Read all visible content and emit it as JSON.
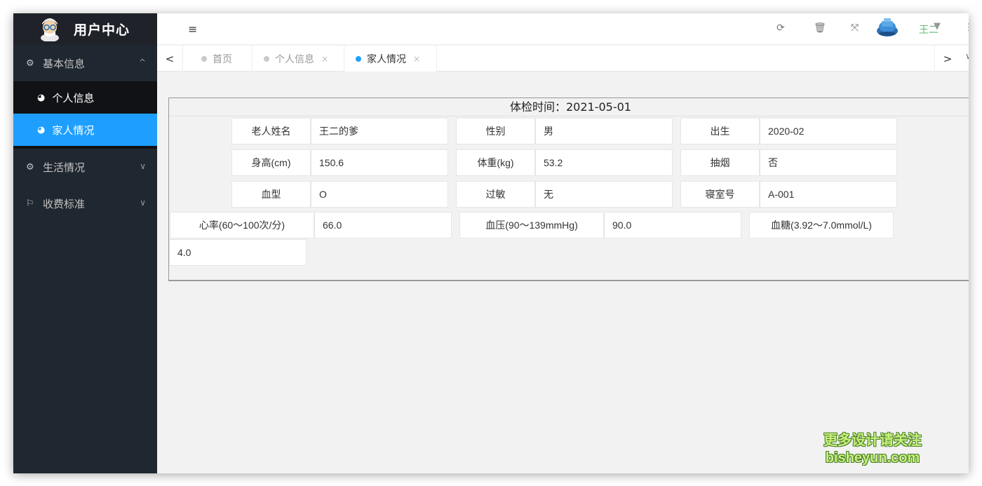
{
  "sidebar": {
    "title": "用户中心",
    "groups": [
      {
        "label": "基本信息",
        "icon": "gears-icon",
        "chevron": "^"
      },
      {
        "label": "生活情况",
        "icon": "gears-icon",
        "chevron": "∨"
      },
      {
        "label": "收费标准",
        "icon": "flag-icon",
        "chevron": "∨"
      }
    ],
    "sub_items": [
      {
        "label": "个人信息",
        "icon": "dashboard-icon"
      },
      {
        "label": "家人情况",
        "icon": "dashboard-icon"
      }
    ]
  },
  "header": {
    "fold_icon": "≡",
    "icons": [
      "refresh-icon",
      "trash-icon",
      "fullscreen-icon"
    ],
    "user_name": "王二",
    "caret": "▼",
    "dots": "⋮"
  },
  "tabs": {
    "left_arrow": "<",
    "right_arrow": ">",
    "more_arrow": "∨",
    "items": [
      {
        "label": "首页"
      },
      {
        "label": "个人信息",
        "close": "×"
      },
      {
        "label": "家人情况",
        "close": "×"
      }
    ]
  },
  "record": {
    "title": "体检时间：2021-05-01",
    "rows": [
      [
        {
          "label": "老人姓名",
          "value": "王二的爹"
        },
        {
          "label": "性别",
          "value": "男"
        },
        {
          "label": "出生",
          "value": "2020-02"
        }
      ],
      [
        {
          "label": "身高(cm)",
          "value": "150.6"
        },
        {
          "label": "体重(kg)",
          "value": "53.2"
        },
        {
          "label": "抽烟",
          "value": "否"
        }
      ],
      [
        {
          "label": "血型",
          "value": "O"
        },
        {
          "label": "过敏",
          "value": "无"
        },
        {
          "label": "寝室号",
          "value": "A-001"
        }
      ]
    ],
    "vitals": [
      {
        "label": "心率(60～100次/分)",
        "value": "66.0"
      },
      {
        "label": "血压(90～139mmHg)",
        "value": "90.0"
      },
      {
        "label": "血糖(3.92～7.0mmol/L)",
        "value": "4.0"
      }
    ]
  },
  "watermark": {
    "line1": "更多设计请关注",
    "line2": "bisheyun.com"
  },
  "colors": {
    "sidebar_bg": "#1f2730",
    "active_blue": "#1e9fff",
    "user_green": "#5fb878"
  }
}
